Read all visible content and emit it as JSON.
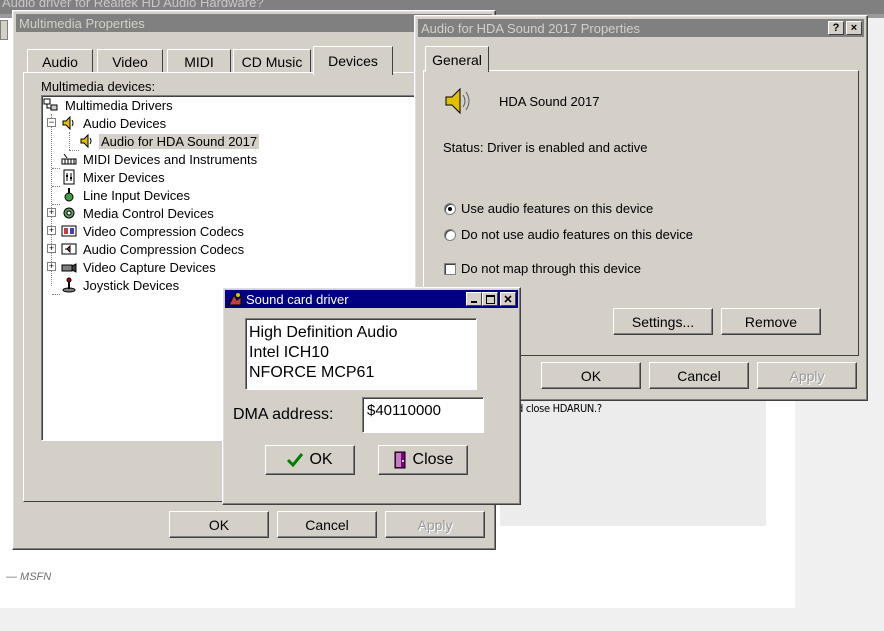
{
  "background": {
    "window_title": "Audio driver for Realtek HD Audio Hardware?",
    "snippet": "d close HDARUN.?",
    "signature": "— MSFN"
  },
  "multimedia": {
    "title": "Multimedia Properties",
    "tabs": [
      "Audio",
      "Video",
      "MIDI",
      "CD Music",
      "Devices"
    ],
    "selected_tab": "Devices",
    "devices_label": "Multimedia devices:",
    "tree": [
      {
        "label": "Multimedia Drivers",
        "icon": "drivers-icon",
        "expander": ""
      },
      {
        "label": "Audio Devices",
        "icon": "speaker-icon",
        "expander": "−"
      },
      {
        "label": "Audio for HDA Sound 2017",
        "icon": "speaker-icon",
        "expander": "",
        "selected": true
      },
      {
        "label": "MIDI Devices and Instruments",
        "icon": "midi-icon",
        "expander": ""
      },
      {
        "label": "Mixer Devices",
        "icon": "mixer-icon",
        "expander": ""
      },
      {
        "label": "Line Input Devices",
        "icon": "line-input-icon",
        "expander": ""
      },
      {
        "label": "Media Control Devices",
        "icon": "media-control-icon",
        "expander": "+"
      },
      {
        "label": "Video Compression Codecs",
        "icon": "video-codec-icon",
        "expander": "+"
      },
      {
        "label": "Audio Compression Codecs",
        "icon": "audio-codec-icon",
        "expander": "+"
      },
      {
        "label": "Video Capture Devices",
        "icon": "video-capture-icon",
        "expander": "+"
      },
      {
        "label": "Joystick Devices",
        "icon": "joystick-icon",
        "expander": ""
      }
    ],
    "buttons": {
      "ok": "OK",
      "cancel": "Cancel",
      "apply": "Apply"
    }
  },
  "hda": {
    "title": "Audio for HDA Sound 2017  Properties",
    "help": "?",
    "close": "×",
    "tab": "General",
    "device_name": "HDA Sound 2017",
    "status": "Status: Driver is enabled and active",
    "radio_use": "Use audio features on this device",
    "radio_dont": "Do not use audio features on this device",
    "radio_selected": "use",
    "check_map": "Do not map through this device",
    "check_map_checked": false,
    "buttons": {
      "settings": "Settings...",
      "remove": "Remove",
      "ok": "OK",
      "cancel": "Cancel",
      "apply": "Apply"
    }
  },
  "sound_card": {
    "title": "Sound card driver",
    "lines": [
      "High Definition Audio",
      "Intel ICH10",
      "NFORCE MCP61"
    ],
    "dma_label": "DMA address:",
    "dma_value": "$40110000",
    "buttons": {
      "ok": "OK",
      "close": "Close"
    },
    "colors": {
      "check": "#008000",
      "close_icon": "#800080"
    }
  }
}
